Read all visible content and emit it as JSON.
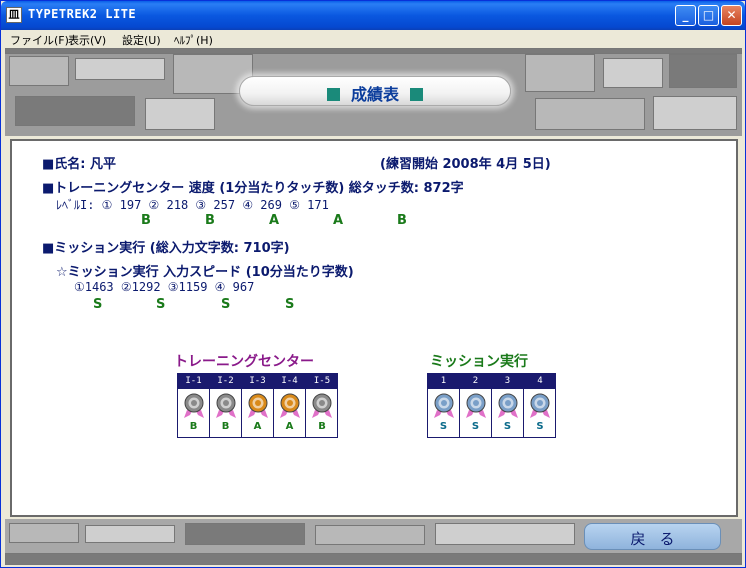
{
  "window": {
    "title": "TYPETREK2 LITE",
    "app_icon_glyph": "皿",
    "minimize_glyph": "_",
    "maximize_glyph": "□",
    "close_glyph": "✕"
  },
  "menu": [
    {
      "label": "ファイル(F)"
    },
    {
      "label": "表示(V)"
    },
    {
      "label": "設定(U)"
    },
    {
      "label": "ﾍﾙﾌﾟ(H)"
    }
  ],
  "banner": {
    "title": "成績表"
  },
  "report": {
    "name_line": "■氏名: 凡平",
    "start_line": "(練習開始 2008年 4月 5日)",
    "training_line": "■トレーニングセンター 速度 (1分当たりタッチ数) 総タッチ数: 872字",
    "training_values": "ﾚﾍﾞﾙI: ① 197 ② 218 ③ 257 ④ 269 ⑤ 171",
    "training_grades": [
      "B",
      "B",
      "A",
      "A",
      "B"
    ],
    "mission_line": "■ミッション実行 (総入力文字数: 710字)",
    "mission_sub_line": "☆ミッション実行 入力スピード (10分当たり字数)",
    "mission_values": "①1463 ②1292 ③1159 ④ 967",
    "mission_grades": [
      "S",
      "S",
      "S",
      "S"
    ]
  },
  "badges": {
    "training": {
      "title": "トレーニングセンター",
      "headers": [
        "I-1",
        "I-2",
        "I-3",
        "I-4",
        "I-5"
      ],
      "grades": [
        "B",
        "B",
        "A",
        "A",
        "B"
      ],
      "medals": [
        "silver",
        "silver",
        "gold",
        "gold",
        "silver"
      ]
    },
    "mission": {
      "title": "ミッション実行",
      "headers": [
        "1",
        "2",
        "3",
        "4"
      ],
      "grades": [
        "S",
        "S",
        "S",
        "S"
      ],
      "medals": [
        "blue",
        "blue",
        "blue",
        "blue"
      ]
    }
  },
  "colors": {
    "medal_silver": "#8a8a8a",
    "medal_gold": "#d98a1a",
    "medal_blue": "#7a9fc8",
    "ribbon": "#e070c8"
  },
  "back_button": {
    "label": "戻る"
  }
}
